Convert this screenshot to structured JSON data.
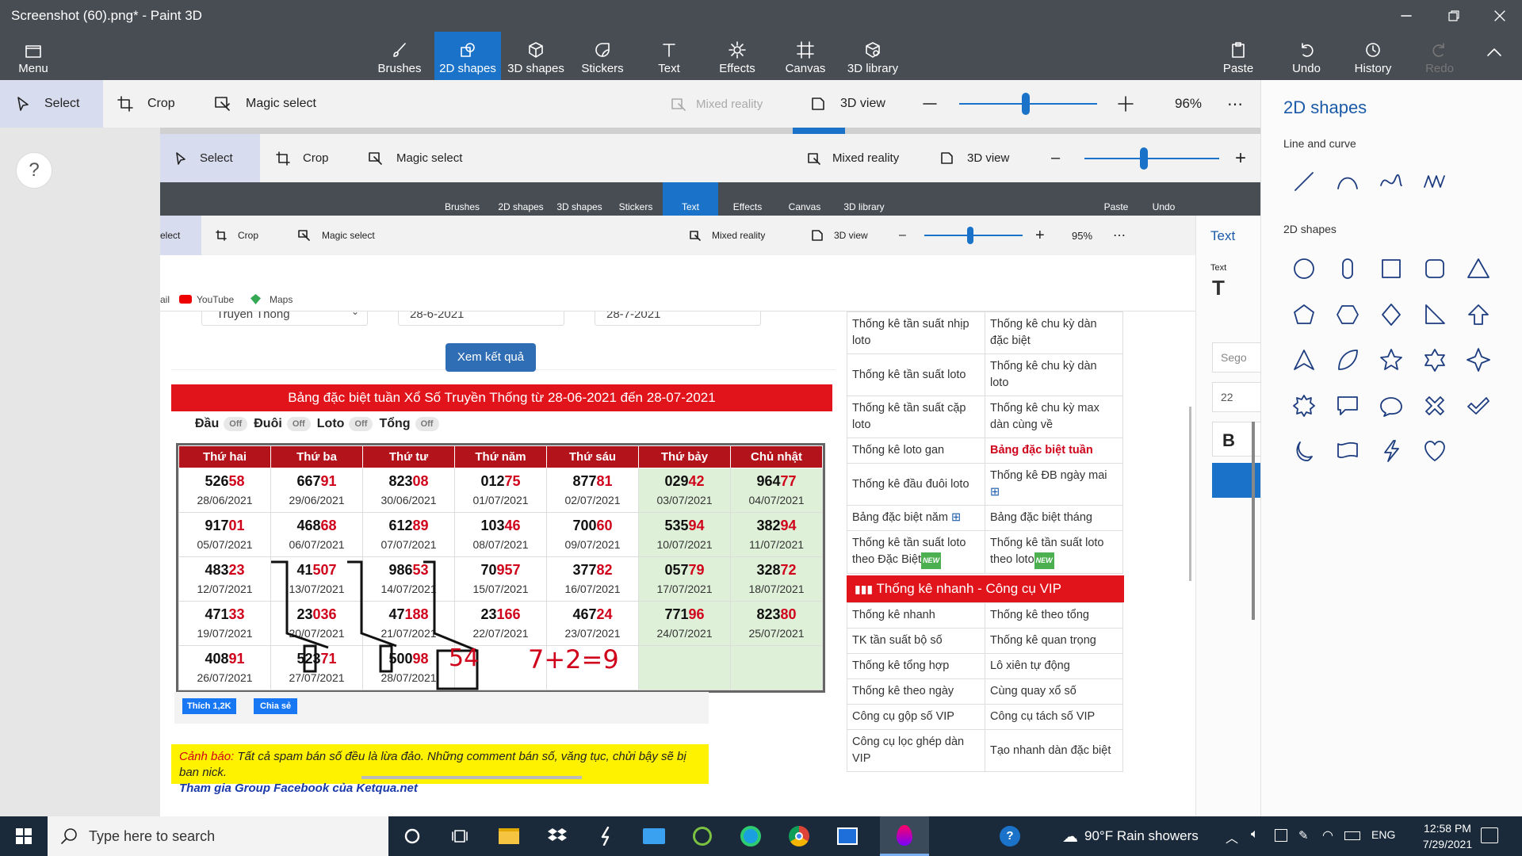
{
  "title": "Screenshot (60).png* - Paint 3D",
  "ribbon": {
    "menu": "Menu",
    "tabs": [
      "Brushes",
      "2D shapes",
      "3D shapes",
      "Stickers",
      "Text",
      "Effects",
      "Canvas",
      "3D library"
    ],
    "right": [
      "Paste",
      "Undo",
      "History",
      "Redo"
    ]
  },
  "toolbar": {
    "select": "Select",
    "crop": "Crop",
    "magic": "Magic select",
    "mixed": "Mixed reality",
    "view3d": "3D view",
    "zoom": "96%",
    "zoom_level": 0.48
  },
  "panel": {
    "title": "2D shapes",
    "line_section": "Line and curve",
    "shape_section": "2D shapes",
    "line_icons": [
      "line-icon",
      "arc-icon",
      "curve-icon",
      "wave-icon"
    ],
    "shape_icons": [
      "circle-icon",
      "capsule-icon",
      "square-icon",
      "rounded-square-icon",
      "triangle-icon",
      "pentagon-icon",
      "hexagon-icon",
      "diamond-icon",
      "right-triangle-icon",
      "arrow-up-icon",
      "triangle-outline-icon",
      "leaf-icon",
      "star5-icon",
      "star6-icon",
      "star4-icon",
      "burst-icon",
      "speech-rect-icon",
      "speech-oval-icon",
      "cross-icon",
      "check-icon",
      "moon-icon",
      "banner-icon",
      "lightning-icon",
      "heart-icon"
    ]
  },
  "nested": {
    "toolbar1": {
      "select": "Select",
      "crop": "Crop",
      "magic": "Magic select",
      "mixed": "Mixed reality",
      "view3d": "3D view"
    },
    "tabs": [
      "Brushes",
      "2D shapes",
      "3D shapes",
      "Stickers",
      "Text",
      "Effects",
      "Canvas",
      "3D library"
    ],
    "right": [
      "Paste",
      "Undo"
    ],
    "toolbar2": {
      "select": "elect",
      "crop": "Crop",
      "magic": "Magic select",
      "mixed": "Mixed reality",
      "view3d": "3D view",
      "zoom": "95%"
    },
    "inner_panel": {
      "title": "Text",
      "sub": "Text",
      "font": "Sego",
      "size": "22",
      "bold": "B"
    },
    "bookmarks": [
      "ail",
      "YouTube",
      "Maps"
    ]
  },
  "web": {
    "filter_select": "Truyen Thong",
    "date_from": "28-6-2021",
    "date_to": "28-7-2021",
    "submit": "Xem kết quả",
    "banner": "Bảng đặc biệt tuần Xổ Số Truyền Thống từ 28-06-2021 đến 28-07-2021",
    "toggles": [
      {
        "label": "Đầu",
        "state": "Off"
      },
      {
        "label": "Đuôi",
        "state": "Off"
      },
      {
        "label": "Loto",
        "state": "Off"
      },
      {
        "label": "Tổng",
        "state": "Off"
      }
    ],
    "days": [
      "Thứ hai",
      "Thứ ba",
      "Thứ tư",
      "Thứ năm",
      "Thứ sáu",
      "Thứ bảy",
      "Chủ nhật"
    ],
    "rows": [
      [
        {
          "a": "526",
          "b": "58",
          "d": "28/06/2021"
        },
        {
          "a": "667",
          "b": "91",
          "d": "29/06/2021"
        },
        {
          "a": "823",
          "b": "08",
          "d": "30/06/2021"
        },
        {
          "a": "012",
          "b": "75",
          "d": "01/07/2021"
        },
        {
          "a": "877",
          "b": "81",
          "d": "02/07/2021"
        },
        {
          "a": "029",
          "b": "42",
          "d": "03/07/2021"
        },
        {
          "a": "964",
          "b": "77",
          "d": "04/07/2021"
        }
      ],
      [
        {
          "a": "917",
          "b": "01",
          "d": "05/07/2021"
        },
        {
          "a": "468",
          "b": "68",
          "d": "06/07/2021"
        },
        {
          "a": "612",
          "b": "89",
          "d": "07/07/2021"
        },
        {
          "a": "103",
          "b": "46",
          "d": "08/07/2021"
        },
        {
          "a": "700",
          "b": "60",
          "d": "09/07/2021"
        },
        {
          "a": "535",
          "b": "94",
          "d": "10/07/2021"
        },
        {
          "a": "382",
          "b": "94",
          "d": "11/07/2021"
        }
      ],
      [
        {
          "a": "483",
          "b": "23",
          "d": "12/07/2021"
        },
        {
          "a": "41",
          "b": "507",
          "d": "13/07/2021"
        },
        {
          "a": "986",
          "b": "53",
          "d": "14/07/2021"
        },
        {
          "a": "70",
          "b": "957",
          "d": "15/07/2021"
        },
        {
          "a": "377",
          "b": "82",
          "d": "16/07/2021"
        },
        {
          "a": "057",
          "b": "79",
          "d": "17/07/2021"
        },
        {
          "a": "328",
          "b": "72",
          "d": "18/07/2021"
        }
      ],
      [
        {
          "a": "471",
          "b": "33",
          "d": "19/07/2021"
        },
        {
          "a": "23",
          "b": "036",
          "d": "20/07/2021"
        },
        {
          "a": "47",
          "b": "188",
          "d": "21/07/2021"
        },
        {
          "a": "23",
          "b": "166",
          "d": "22/07/2021"
        },
        {
          "a": "467",
          "b": "24",
          "d": "23/07/2021"
        },
        {
          "a": "771",
          "b": "96",
          "d": "24/07/2021"
        },
        {
          "a": "823",
          "b": "80",
          "d": "25/07/2021"
        }
      ],
      [
        {
          "a": "408",
          "b": "91",
          "d": "26/07/2021"
        },
        {
          "a": "523",
          "b": "71",
          "d": "27/07/2021"
        },
        {
          "a": "500",
          "b": "98",
          "d": "28/07/2021"
        },
        {
          "a": "",
          "b": "",
          "d": ""
        },
        {
          "a": "",
          "b": "",
          "d": ""
        },
        {
          "a": "",
          "b": "",
          "d": ""
        },
        {
          "a": "",
          "b": "",
          "d": ""
        }
      ]
    ],
    "annotation_54": "54",
    "annotation_eq": "7+2=9",
    "like": "Thích 1,2K",
    "share": "Chia sẻ",
    "warning_label": "Cảnh báo:",
    "warning_text": "Tất cả spam bán số đều là lừa đảo. Những comment bán số, văng tục, chửi bậy sẽ bị ban nick.",
    "group_link": "Tham gia Group Facebook của Ketqua.net",
    "side_top": [
      [
        "Thống kê tần suất nhịp loto",
        "Thống kê chu kỳ dàn đặc biệt"
      ],
      [
        "Thống kê tần suất loto",
        "Thống kê chu kỳ dàn loto"
      ],
      [
        "Thống kê tần suất cặp loto",
        "Thống kê chu kỳ max dàn cùng về"
      ],
      [
        "Thống kê loto gan",
        "Bảng đặc biệt tuần"
      ],
      [
        "Thống kê đầu đuôi loto",
        "Thống kê ĐB ngày mai"
      ],
      [
        "Bảng đặc biệt năm",
        "Bảng đặc biệt tháng"
      ],
      [
        "Thống kê tần suất loto theo Đặc Biệt",
        "Thống kê tần suất loto theo loto"
      ]
    ],
    "vip_title": "Thống kê nhanh - Công cụ VIP",
    "side_vip": [
      [
        "Thống kê nhanh",
        "Thống kê theo tổng"
      ],
      [
        "TK tần suất bộ số",
        "Thống kê quan trọng"
      ],
      [
        "Thống kê tổng hợp",
        "Lô xiên tự động"
      ],
      [
        "Thống kê theo ngày",
        "Cùng quay xổ số"
      ],
      [
        "Công cụ gộp số VIP",
        "Công cụ tách số VIP"
      ],
      [
        "Công cụ lọc ghép dàn VIP",
        "Tạo nhanh dàn đặc biệt"
      ]
    ],
    "new_badge": "NEW"
  },
  "taskbar": {
    "search": "Type here to search",
    "weather": "90°F  Rain showers",
    "lang": "ENG",
    "time": "12:58 PM",
    "date": "7/29/2021"
  },
  "colors": {
    "accent": "#1a73c9",
    "red": "#e1141c",
    "titlebar": "#484c53",
    "taskbar": "#1b2a3a",
    "shape": "#1d3d80"
  }
}
